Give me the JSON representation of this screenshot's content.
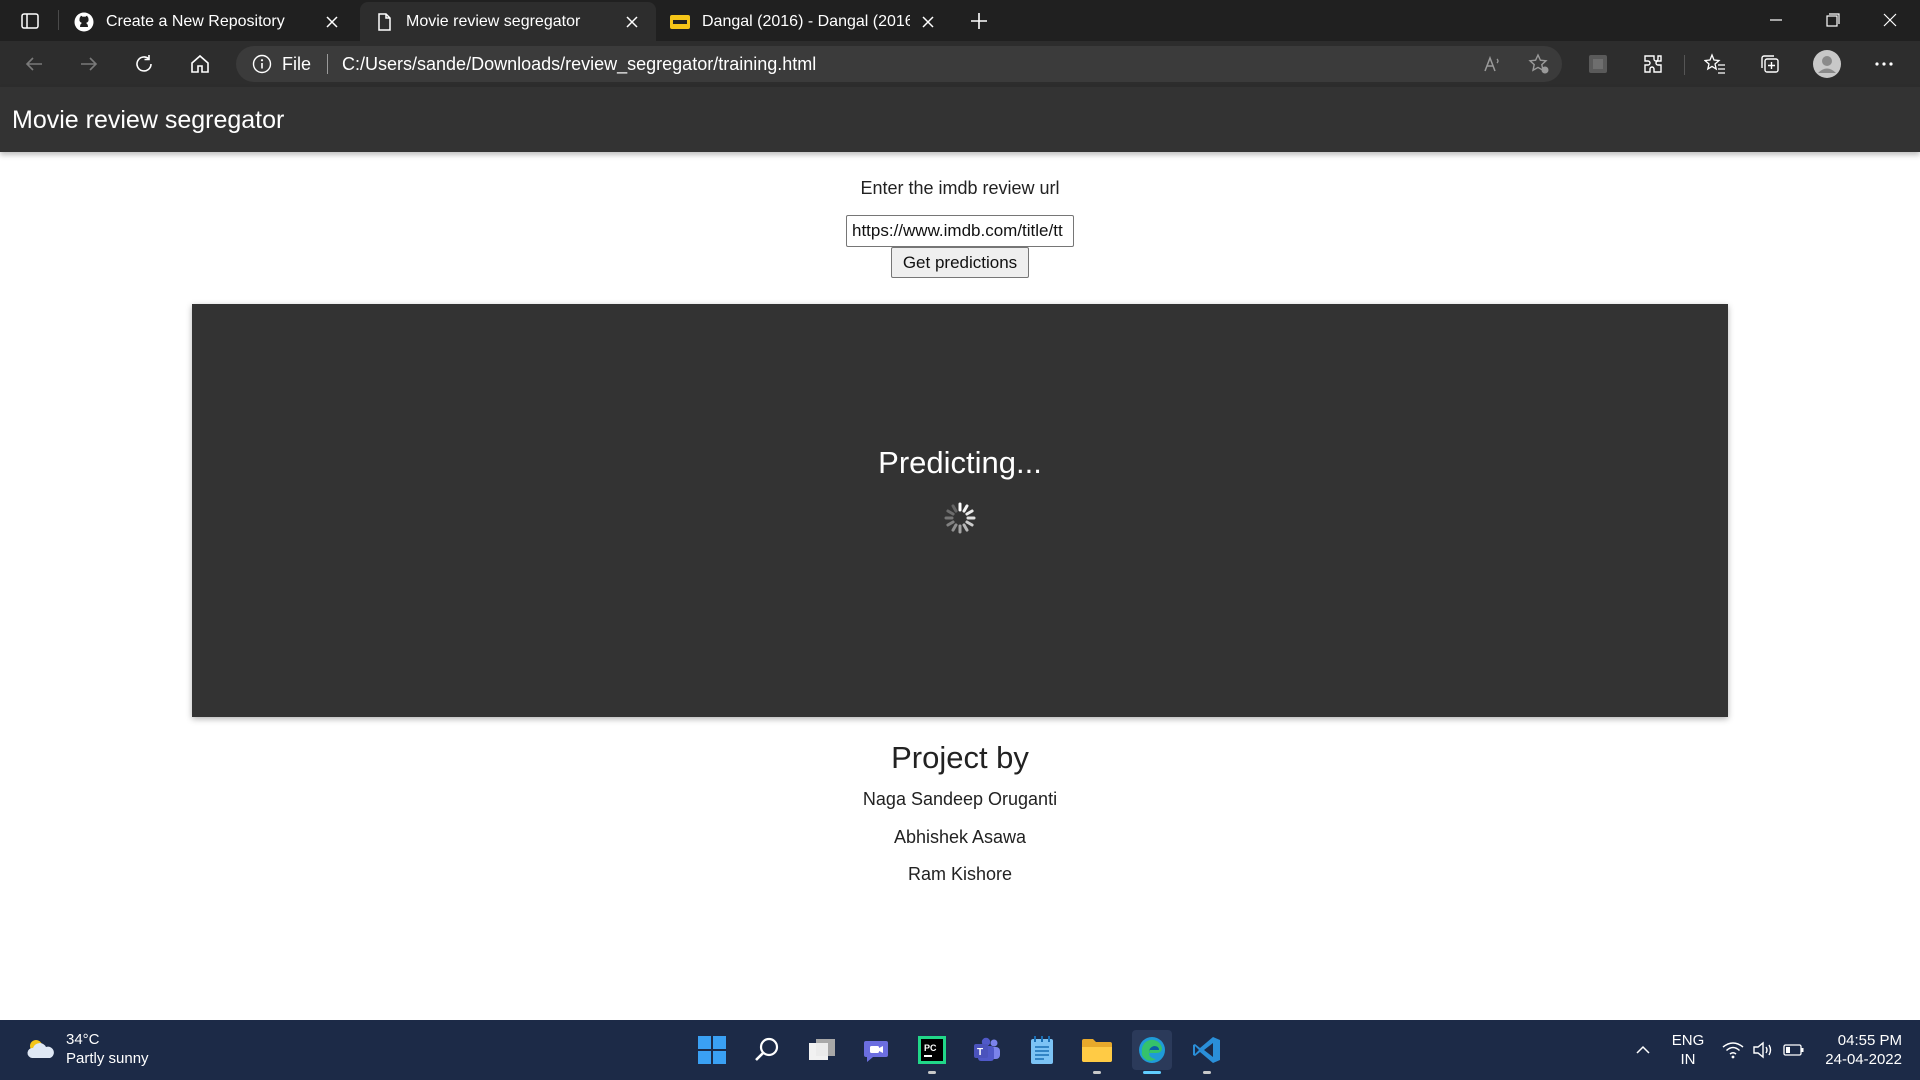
{
  "browser": {
    "tabs": [
      {
        "title": "Create a New Repository",
        "icon": "github-icon"
      },
      {
        "title": "Movie review segregator",
        "icon": "page-icon"
      },
      {
        "title": "Dangal (2016) - Dangal (2016) - ",
        "icon": "imdb-icon"
      }
    ],
    "address": {
      "scheme_label": "File",
      "url": "C:/Users/sande/Downloads/review_segregator/training.html"
    }
  },
  "page": {
    "header_title": "Movie review segregator",
    "prompt_label": "Enter the imdb review url",
    "url_input_value": "https://www.imdb.com/title/tt",
    "predict_button": "Get predictions",
    "status_text": "Predicting...",
    "credits_title": "Project by",
    "credits": [
      "Naga Sandeep Oruganti",
      "Abhishek Asawa",
      "Ram Kishore"
    ]
  },
  "taskbar": {
    "weather_temp": "34°C",
    "weather_desc": "Partly sunny",
    "lang_line1": "ENG",
    "lang_line2": "IN",
    "time": "04:55 PM",
    "date": "24-04-2022"
  },
  "colors": {
    "header_bg": "#333333",
    "panel_bg": "#333333",
    "browser_dark": "#202020",
    "taskbar_bg": "#1c2a47",
    "edge_accent": "#60cdff"
  }
}
